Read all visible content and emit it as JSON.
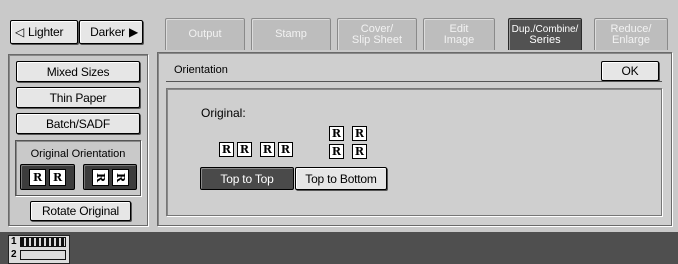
{
  "density": {
    "lighter": "Lighter",
    "darker": "Darker"
  },
  "tabs": [
    {
      "line1": "Output",
      "line2": ""
    },
    {
      "line1": "Stamp",
      "line2": ""
    },
    {
      "line1": "Cover/",
      "line2": "Slip Sheet"
    },
    {
      "line1": "Edit",
      "line2": "Image"
    },
    {
      "line1": "Dup./Combine/",
      "line2": "Series"
    },
    {
      "line1": "Reduce/",
      "line2": "Enlarge"
    }
  ],
  "left_panel": {
    "mixed_sizes": "Mixed Sizes",
    "thin_paper": "Thin Paper",
    "batch_sadf": "Batch/SADF",
    "orientation_label": "Original Orientation",
    "rotate_original": "Rotate Original"
  },
  "dialog": {
    "title": "Orientation",
    "ok": "OK",
    "original_label": "Original:",
    "top_to_top": "Top to Top",
    "top_to_bottom": "Top to Bottom",
    "letter": "R"
  },
  "status": {
    "tray1": "1",
    "tray2": "2"
  },
  "colors": {
    "active_tab": "#525252",
    "selected_button": "#4a4a4a",
    "status_bar": "#4f4f4f"
  }
}
